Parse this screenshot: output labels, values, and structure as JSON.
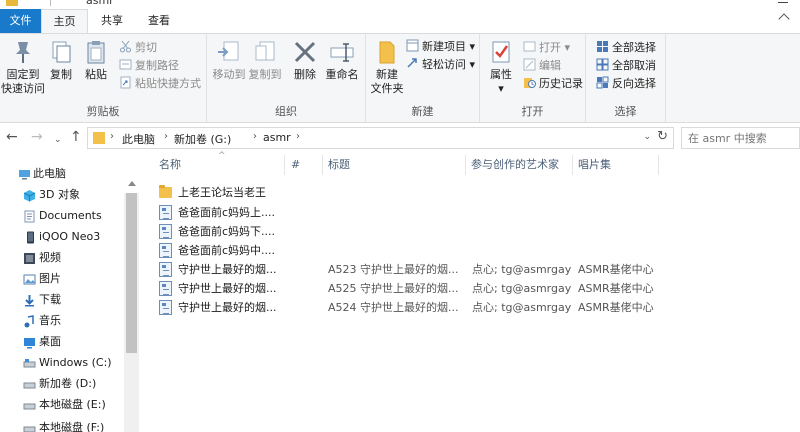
{
  "window": {
    "title": "asmr"
  },
  "tabs": {
    "file": "文件",
    "home": "主页",
    "share": "共享",
    "view": "查看"
  },
  "ribbon": {
    "clipboard": {
      "label": "剪贴板",
      "pin": "固定到\n快速访问",
      "pin_l1": "固定到",
      "pin_l2": "快速访问",
      "copy": "复制",
      "paste": "粘贴",
      "cut": "剪切",
      "copy_path": "复制路径",
      "paste_shortcut": "粘贴快捷方式"
    },
    "organize": {
      "label": "组织",
      "move_to": "移动到",
      "copy_to": "复制到",
      "delete": "删除",
      "rename": "重命名"
    },
    "new": {
      "label": "新建",
      "new_folder_l1": "新建",
      "new_folder_l2": "文件夹",
      "new_item": "新建项目",
      "easy_access": "轻松访问"
    },
    "open": {
      "label": "打开",
      "properties": "属性",
      "open": "打开",
      "edit": "编辑",
      "history": "历史记录"
    },
    "select": {
      "label": "选择",
      "select_all": "全部选择",
      "select_none": "全部取消",
      "invert": "反向选择"
    }
  },
  "address": {
    "crumbs": [
      "此电脑",
      "新加卷 (G:)",
      "asmr"
    ],
    "search_placeholder": "在 asmr 中搜索"
  },
  "nav": {
    "items": [
      {
        "label": "此电脑",
        "icon": "computer-icon"
      },
      {
        "label": "3D 对象",
        "icon": "3d-objects-icon"
      },
      {
        "label": "Documents",
        "icon": "documents-icon"
      },
      {
        "label": "iQOO Neo3",
        "icon": "phone-icon"
      },
      {
        "label": "视频",
        "icon": "video-icon"
      },
      {
        "label": "图片",
        "icon": "pictures-icon"
      },
      {
        "label": "下载",
        "icon": "download-icon"
      },
      {
        "label": "音乐",
        "icon": "music-icon"
      },
      {
        "label": "桌面",
        "icon": "desktop-icon"
      },
      {
        "label": "Windows (C:)",
        "icon": "drive-icon"
      },
      {
        "label": "新加卷 (D:)",
        "icon": "drive-icon"
      },
      {
        "label": "本地磁盘 (E:)",
        "icon": "drive-icon"
      },
      {
        "label": "本地磁盘 (F:)",
        "icon": "drive-icon"
      }
    ]
  },
  "columns": {
    "name": "名称",
    "number": "#",
    "title": "标题",
    "artist": "参与创作的艺术家",
    "album": "唱片集"
  },
  "files": [
    {
      "name": "上老王论坛当老王",
      "type": "folder",
      "title": "",
      "artist": "",
      "album": ""
    },
    {
      "name": "爸爸面前c妈妈上....",
      "type": "audio",
      "title": "",
      "artist": "",
      "album": ""
    },
    {
      "name": "爸爸面前c妈妈下....",
      "type": "audio",
      "title": "",
      "artist": "",
      "album": ""
    },
    {
      "name": "爸爸面前c妈妈中....",
      "type": "audio",
      "title": "",
      "artist": "",
      "album": ""
    },
    {
      "name": "守护世上最好的烟...",
      "type": "audio",
      "title": "A523 守护世上最好的烟...",
      "artist": "点心; tg@asmrgay",
      "album": "ASMR基佬中心"
    },
    {
      "name": "守护世上最好的烟...",
      "type": "audio",
      "title": "A525 守护世上最好的烟...",
      "artist": "点心; tg@asmrgay",
      "album": "ASMR基佬中心"
    },
    {
      "name": "守护世上最好的烟...",
      "type": "audio",
      "title": "A524 守护世上最好的烟...",
      "artist": "点心; tg@asmrgay",
      "album": "ASMR基佬中心"
    }
  ]
}
